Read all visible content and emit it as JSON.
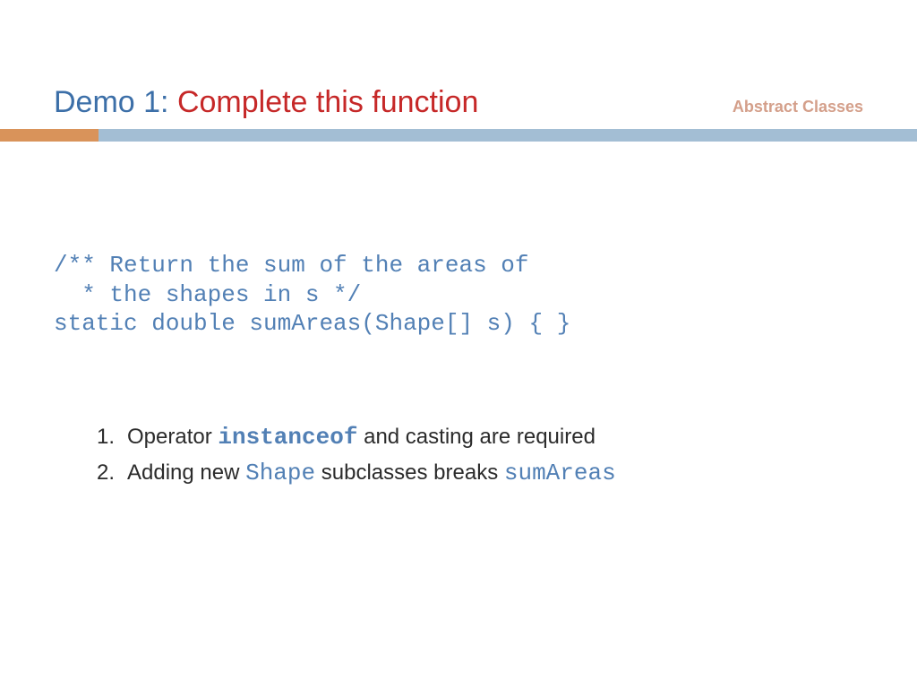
{
  "header": {
    "title_prefix": "Demo 1: ",
    "title_main": "Complete this function",
    "subtitle": "Abstract Classes"
  },
  "code": {
    "line1": "/** Return the sum of the areas of",
    "line2": "  * the shapes in s */",
    "line3": "static double sumAreas(Shape[] s) { }"
  },
  "points": {
    "p1": {
      "num": "1.",
      "t1": "Operator ",
      "kw": "instanceof",
      "t2": " and casting are required"
    },
    "p2": {
      "num": "2.",
      "t1": "Adding new ",
      "kw1": "Shape",
      "t2": " subclasses breaks ",
      "kw2": "sumAreas"
    }
  }
}
